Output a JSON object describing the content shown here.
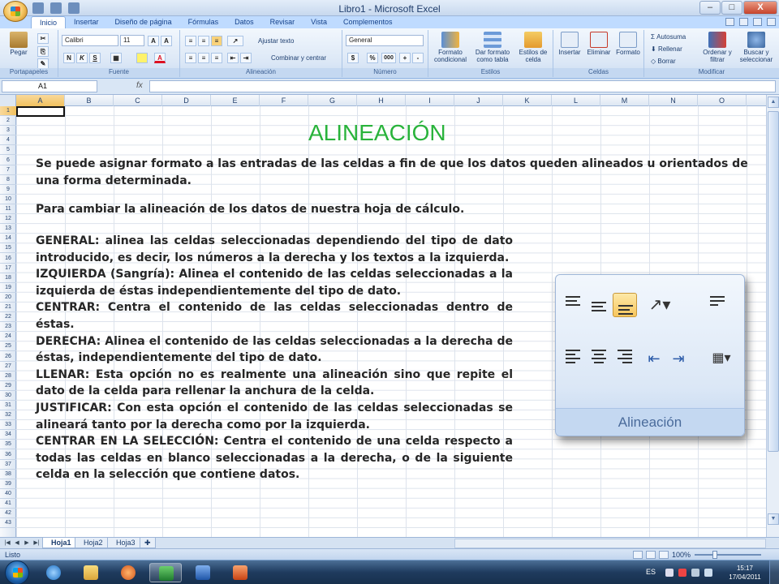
{
  "window": {
    "title": "Libro1 - Microsoft Excel",
    "controls": {
      "minimize": "–",
      "maximize": "□",
      "close": "X"
    }
  },
  "ribbon_tabs": [
    "Inicio",
    "Insertar",
    "Diseño de página",
    "Fórmulas",
    "Datos",
    "Revisar",
    "Vista",
    "Complementos"
  ],
  "ribbon": {
    "portapapeles": {
      "label": "Portapapeles",
      "paste": "Pegar"
    },
    "fuente": {
      "label": "Fuente",
      "font_name": "Calibri",
      "font_size": "11",
      "bold": "N",
      "italic": "K",
      "underline": "S",
      "font_color_letter": "A"
    },
    "alineacion": {
      "label": "Alineación",
      "wrap": "Ajustar texto",
      "merge": "Combinar y centrar"
    },
    "numero": {
      "label": "Número",
      "format": "General",
      "currency": "$",
      "percent": "%",
      "thousands": "000"
    },
    "estilos": {
      "label": "Estilos",
      "conditional": "Formato condicional",
      "table": "Dar formato como tabla",
      "cell_styles": "Estilos de celda"
    },
    "celdas": {
      "label": "Celdas",
      "insert": "Insertar",
      "delete": "Eliminar",
      "format": "Formato"
    },
    "modificar": {
      "label": "Modificar",
      "autosum": "Autosuma",
      "fill": "Rellenar",
      "clear": "Borrar",
      "sort": "Ordenar y filtrar",
      "find": "Buscar y seleccionar"
    }
  },
  "formula_bar": {
    "name_box": "A1",
    "fx": "fx",
    "value": ""
  },
  "columns": [
    "A",
    "B",
    "C",
    "D",
    "E",
    "F",
    "G",
    "H",
    "I",
    "J",
    "K",
    "L",
    "M",
    "N",
    "O"
  ],
  "rows": [
    "1",
    "2",
    "3",
    "4",
    "5",
    "6",
    "7",
    "8",
    "9",
    "10",
    "11",
    "12",
    "13",
    "14",
    "15",
    "16",
    "17",
    "18",
    "19",
    "20",
    "21",
    "22",
    "23",
    "24",
    "25",
    "26",
    "27",
    "28",
    "29",
    "30",
    "31",
    "32",
    "33",
    "34",
    "35",
    "36",
    "37",
    "38",
    "39",
    "40",
    "41",
    "42",
    "43"
  ],
  "sheet_content": {
    "title": "ALINEACIÓN",
    "intro": "Se puede asignar formato a las entradas de las celdas a fin de que los datos queden alineados u orientados de una forma determinada.",
    "intro2": "Para cambiar la alineación de los datos de nuestra hoja de cálculo.",
    "items": [
      "GENERAL: alinea las celdas seleccionadas dependiendo del tipo de dato introducido, es decir, los números a la derecha y los textos a la izquierda.",
      "IZQUIERDA (Sangría): Alinea el contenido de las celdas seleccionadas a la izquierda de éstas independientemente del tipo de dato.",
      "CENTRAR: Centra el contenido de las celdas seleccionadas dentro de éstas.",
      "DERECHA: Alinea el contenido de las celdas seleccionadas a la derecha de éstas, independientemente del tipo de dato.",
      "LLENAR: Esta opción no es realmente una alineación sino que repite el dato de la celda para rellenar la anchura de la celda.",
      "JUSTIFICAR: Con esta opción el contenido de las celdas seleccionadas se alineará tanto por la derecha como por la izquierda.",
      "CENTRAR EN LA SELECCIÓN: Centra el contenido de una celda respecto a todas las celdas en blanco seleccionadas a la derecha, o de la siguiente celda en la selección que contiene datos."
    ],
    "snapshot_label": "Alineación"
  },
  "sheet_tabs": [
    "Hoja1",
    "Hoja2",
    "Hoja3"
  ],
  "status_bar": {
    "text": "Listo",
    "zoom": "100%"
  },
  "taskbar": {
    "language": "ES",
    "time": "15:17",
    "date": "17/04/2011"
  },
  "colors": {
    "title_green": "#29b33b",
    "ribbon_blue": "#bfdbff",
    "text_dark": "#262626"
  }
}
